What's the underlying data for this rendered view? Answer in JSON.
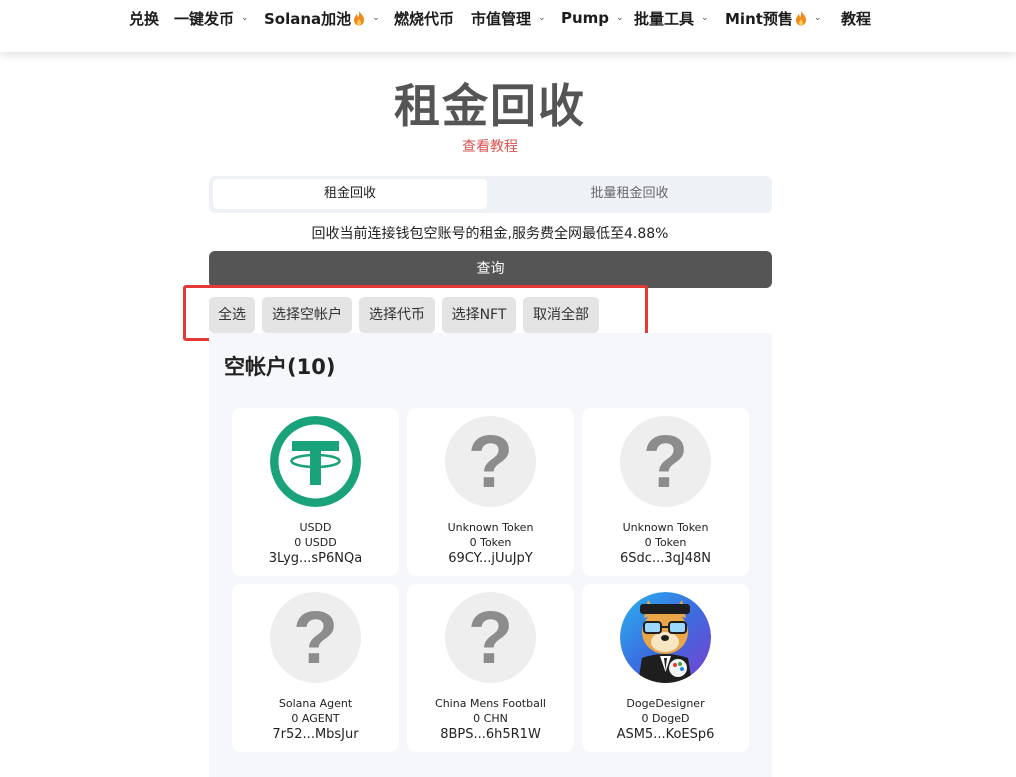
{
  "nav": {
    "items": [
      {
        "label": "兑换",
        "dropdown": false,
        "fire": false
      },
      {
        "label": "一键发币",
        "dropdown": true,
        "fire": false
      },
      {
        "label": "Solana加池",
        "dropdown": true,
        "fire": true
      },
      {
        "label": "燃烧代币",
        "dropdown": false,
        "fire": false
      },
      {
        "label": "市值管理",
        "dropdown": true,
        "fire": false
      },
      {
        "label": "Pump",
        "dropdown": true,
        "fire": false
      },
      {
        "label": "批量工具",
        "dropdown": true,
        "fire": false
      },
      {
        "label": "Mint预售",
        "dropdown": true,
        "fire": true
      },
      {
        "label": "教程",
        "dropdown": false,
        "fire": false
      }
    ]
  },
  "page": {
    "title": "租金回收",
    "tutorial_link": "查看教程",
    "tabs": [
      {
        "label": "租金回收",
        "active": true
      },
      {
        "label": "批量租金回收",
        "active": false
      }
    ],
    "description": "回收当前连接钱包空账号的租金,服务费全网最低至4.88%",
    "query_button": "查询"
  },
  "selection": {
    "buttons": [
      "全选",
      "选择空帐户",
      "选择代币",
      "选择NFT",
      "取消全部"
    ]
  },
  "panel": {
    "title": "空帐户(10)",
    "cards": [
      {
        "icon": "usdd-logo-icon",
        "name": "USDD",
        "amount": "0 USDD",
        "address": "3Lyg...sP6NQa"
      },
      {
        "icon": "question-mark-icon",
        "name": "Unknown Token",
        "amount": "0 Token",
        "address": "69CY...jUuJpY"
      },
      {
        "icon": "question-mark-icon",
        "name": "Unknown Token",
        "amount": "0 Token",
        "address": "6Sdc...3qJ48N"
      },
      {
        "icon": "question-mark-icon",
        "name": "Solana Agent",
        "amount": "0 AGENT",
        "address": "7r52...MbsJur"
      },
      {
        "icon": "question-mark-icon",
        "name": "China Mens Football",
        "amount": "0 CHN",
        "address": "8BPS...6h5R1W"
      },
      {
        "icon": "doge-designer-avatar-icon",
        "name": "DogeDesigner",
        "amount": "0 DogeD",
        "address": "ASM5...KoESp6"
      }
    ]
  },
  "colors": {
    "title_gray": "#555555",
    "link_red": "#d9534f",
    "highlight_red": "#e53935",
    "usdd_green": "#1aa37a"
  }
}
